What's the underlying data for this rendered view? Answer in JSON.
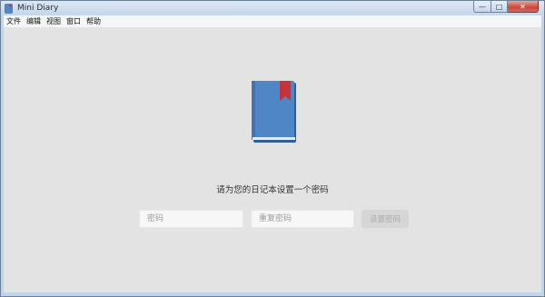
{
  "window": {
    "title": "Mini Diary",
    "controls": {
      "minimize": "—",
      "maximize": "□",
      "close": "✕"
    }
  },
  "menubar": {
    "items": [
      {
        "label": "文件"
      },
      {
        "label": "编辑"
      },
      {
        "label": "视图"
      },
      {
        "label": "窗口"
      },
      {
        "label": "帮助"
      }
    ]
  },
  "main": {
    "icon": "diary-book-icon",
    "prompt": "请为您的日记本设置一个密码",
    "password_placeholder": "密码",
    "repeat_placeholder": "重复密码",
    "submit_label": "设置密码"
  },
  "colors": {
    "content_bg": "#e3e3e3",
    "book_cover": "#4f86c6",
    "bookmark": "#c8323b",
    "button_disabled_bg": "#d6d6d6"
  }
}
